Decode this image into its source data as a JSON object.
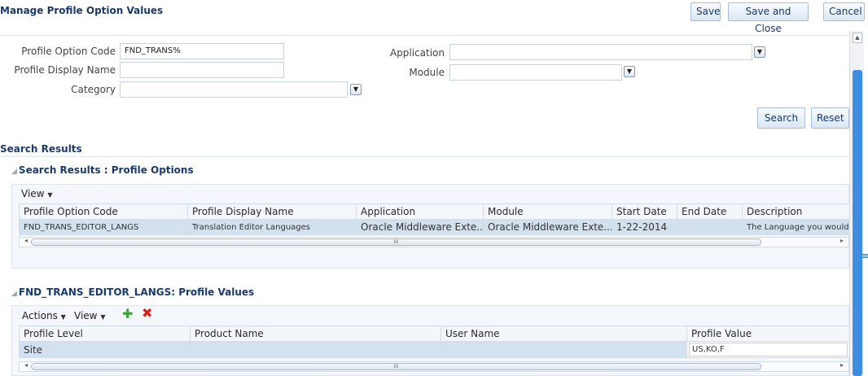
{
  "header": {
    "title": "Manage Profile Option Values",
    "save_label": "Save",
    "save_close_label": "Save and Close",
    "cancel_label": "Cancel"
  },
  "search": {
    "code_label": "Profile Option Code",
    "code_value": "FND_TRANS%",
    "display_name_label": "Profile Display Name",
    "display_name_value": "",
    "category_label": "Category",
    "category_value": "",
    "application_label": "Application",
    "application_value": "",
    "module_label": "Module",
    "module_value": "",
    "search_button": "Search",
    "reset_button": "Reset"
  },
  "results": {
    "section_title": "Search Results",
    "options_title": "Search Results : Profile Options",
    "view_menu": "View",
    "columns": [
      "Profile Option Code",
      "Profile Display Name",
      "Application",
      "Module",
      "Start Date",
      "End Date",
      "Description"
    ],
    "rows": [
      {
        "code": "FND_TRANS_EDITOR_LANGS",
        "display_name": "Translation Editor Languages",
        "application": "Oracle Middleware Exte...",
        "module": "Oracle Middleware Exte...",
        "start_date": "1-22-2014",
        "end_date": "",
        "description": "The Language you would l"
      }
    ]
  },
  "values": {
    "title": "FND_TRANS_EDITOR_LANGS: Profile Values",
    "actions_menu": "Actions",
    "view_menu": "View",
    "add_icon": "plus-icon",
    "delete_icon": "x-icon",
    "columns": [
      "Profile Level",
      "Product Name",
      "User Name",
      "Profile Value"
    ],
    "rows": [
      {
        "level": "Site",
        "product": "",
        "user": "",
        "value": "US,KO,F"
      }
    ]
  },
  "colors": {
    "title_blue": "#1a3a6b",
    "selected_row": "#d3e1ef",
    "scroll_thumb": "#3e8de0",
    "add_green": "#3aa534",
    "delete_red": "#d8231c"
  }
}
